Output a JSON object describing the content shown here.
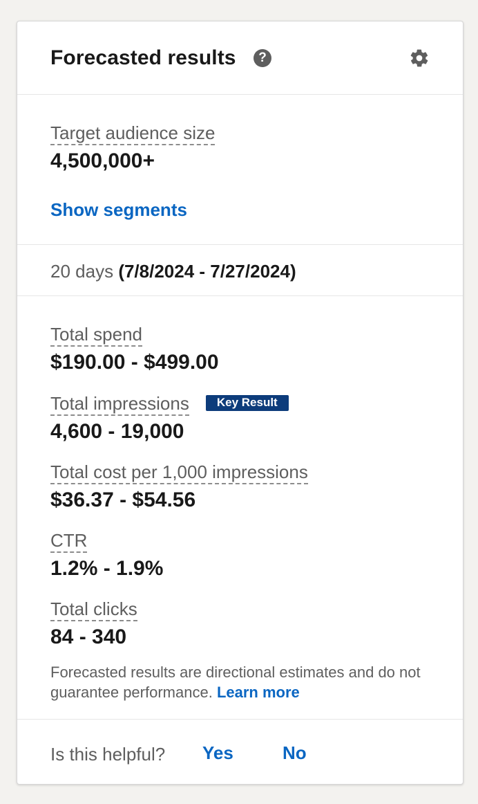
{
  "header": {
    "title": "Forecasted results",
    "help_icon": "question-circle-icon",
    "settings_icon": "gear-icon"
  },
  "audience": {
    "label": "Target audience size",
    "value": "4,500,000+",
    "show_segments": "Show segments"
  },
  "dates": {
    "duration": "20 days",
    "range": "(7/8/2024 - 7/27/2024)"
  },
  "metrics": [
    {
      "label": "Total spend",
      "value": "$190.00 - $499.00"
    },
    {
      "label": "Total impressions",
      "value": "4,600 - 19,000",
      "badge": "Key Result"
    },
    {
      "label": "Total cost per 1,000 impressions",
      "value": "$36.37 - $54.56"
    },
    {
      "label": "CTR",
      "value": "1.2% - 1.9%"
    },
    {
      "label": "Total clicks",
      "value": "84 - 340"
    }
  ],
  "disclaimer": {
    "text": "Forecasted results are directional estimates and do not guarantee performance.",
    "link": "Learn more"
  },
  "feedback": {
    "question": "Is this helpful?",
    "yes": "Yes",
    "no": "No"
  },
  "colors": {
    "accent": "#0a66c2",
    "badge_bg": "#0d3c7b",
    "text_primary": "#191919",
    "text_secondary": "#5e5e5e"
  }
}
